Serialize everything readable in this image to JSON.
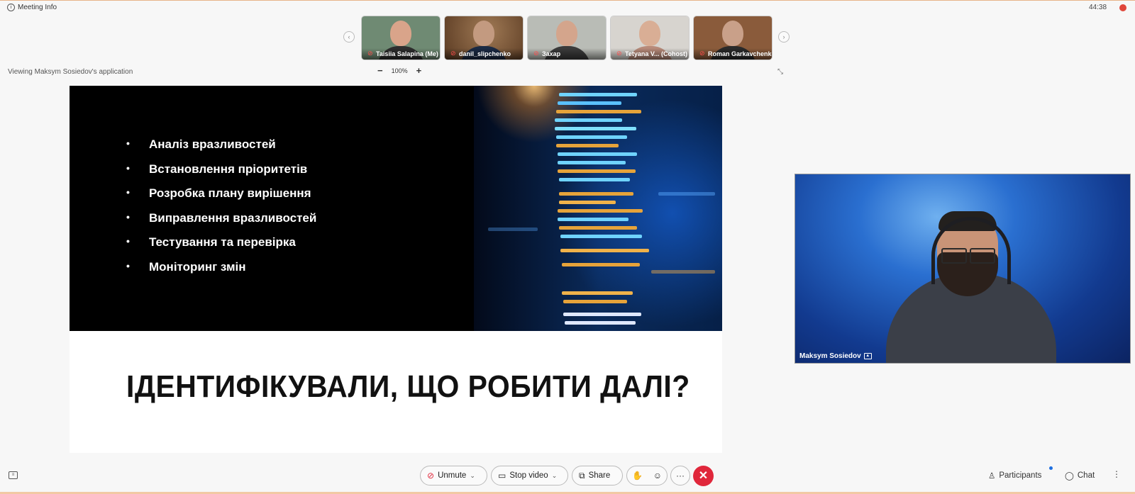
{
  "header": {
    "meeting_info": "Meeting Info",
    "timer": "44:38"
  },
  "participants_strip": [
    {
      "name": "Taisiia Salapina (Me)",
      "bg": "#6f8a73",
      "skin": "#d9a48a",
      "shirt": "#2e2e2e"
    },
    {
      "name": "danil_slipchenko",
      "bg": "#6b4a2c",
      "skin": "#c39a80",
      "shirt": "#1b2a44"
    },
    {
      "name": "Захар",
      "bg": "#b9bcb6",
      "skin": "#d4a58c",
      "shirt": "#3a3a3a"
    },
    {
      "name": "Tetyana V...  (Cohost)",
      "bg": "#d7d4cf",
      "skin": "#d9ae95",
      "shirt": "#b88b7a"
    },
    {
      "name": "Roman Garkavchenko",
      "bg": "#8a5b3b",
      "skin": "#c9a089",
      "shirt": "#2a2a2a"
    }
  ],
  "share_bar": {
    "viewing_text": "Viewing Maksym Sosiedov's application",
    "zoom_minus": "−",
    "zoom_level": "100%",
    "zoom_plus": "+"
  },
  "slide": {
    "bullets": [
      "Аналіз вразливостей",
      "Встановлення пріоритетів",
      "Розробка плану вирішення",
      "Виправлення вразливостей",
      "Тестування та перевірка",
      "Моніторинг змін"
    ],
    "bullet_char": "•",
    "heading": "ІДЕНТИФІКУВАЛИ, ЩО РОБИТИ ДАЛІ?"
  },
  "speaker": {
    "name": "Maksym Sosiedov"
  },
  "controls": {
    "unmute": "Unmute",
    "stop_video": "Stop video",
    "share": "Share",
    "participants": "Participants",
    "chat": "Chat",
    "more": "···",
    "end": "✕"
  },
  "colors": {
    "end_call": "#e0273b",
    "muted_icon": "#ff4d4d",
    "notification": "#1e6fe0"
  }
}
